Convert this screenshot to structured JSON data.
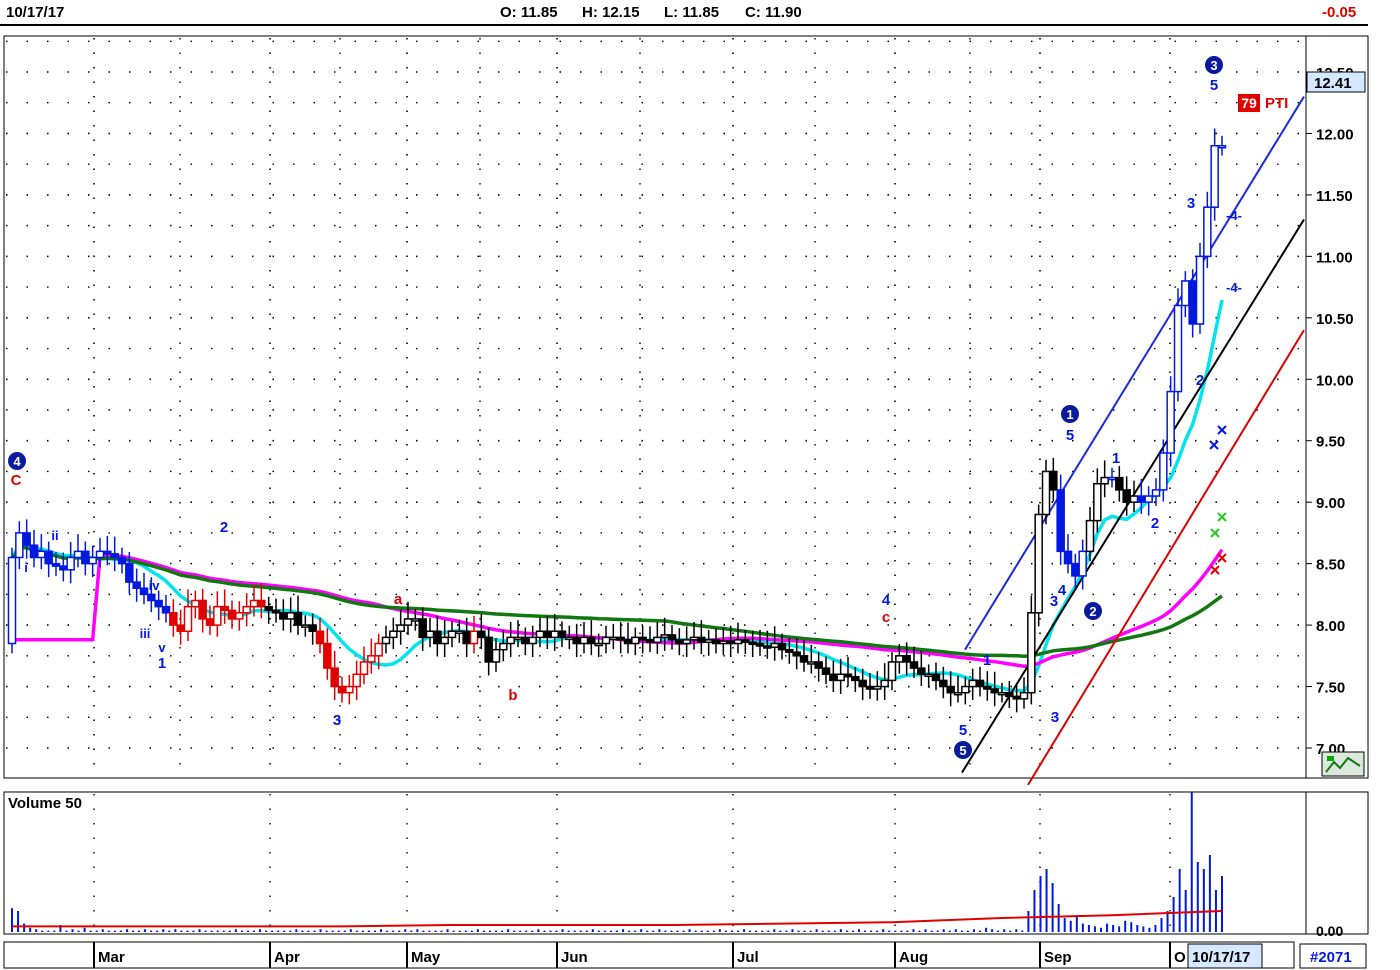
{
  "header": {
    "date": "10/17/17",
    "open": "O: 11.85",
    "high": "H: 12.15",
    "low": "L: 11.85",
    "close": "C: 11.90",
    "change": "-0.05"
  },
  "colors": {
    "down_candle": "#e00000",
    "up_candle_blue": "#0018e0",
    "neutral_candle": "#000000",
    "ma_fast": "#00e5ee",
    "ma_mid": "#ff00ff",
    "ma_slow": "#117711",
    "channel_blue": "#1a2adc",
    "channel_black": "#000000",
    "channel_red": "#e00000"
  },
  "icons": {
    "corner": "chart-tools-icon"
  },
  "chart_data": {
    "type": "candlestick",
    "price_axis": {
      "range": [
        6.9,
        12.9
      ],
      "ticks": [
        "7.00",
        "7.50",
        "8.00",
        "8.50",
        "9.00",
        "9.50",
        "10.00",
        "10.50",
        "11.00",
        "11.50",
        "12.00",
        "12.50"
      ],
      "last_price": "12.41"
    },
    "months": [
      "Mar",
      "Apr",
      "May",
      "Jun",
      "Jul",
      "Aug",
      "Sep",
      "O"
    ],
    "date_marker": "10/17/17",
    "chart_id": "#2071",
    "volume_panel": {
      "title": "Volume 50",
      "ticks": [
        "0.00"
      ],
      "volumes": [
        0.17,
        0.15,
        0.06,
        0.03,
        0.02,
        0.01,
        0.01,
        0.01,
        0.05,
        0.01,
        0.02,
        0.01,
        0.03,
        0.01,
        0.01,
        0.02,
        0.01,
        0.01,
        0.01,
        0.02,
        0.01,
        0.01,
        0.02,
        0.01,
        0.01,
        0.02,
        0.01,
        0.02,
        0.01,
        0.01,
        0.01,
        0.02,
        0.01,
        0.01,
        0.01,
        0.01,
        0.01,
        0.02,
        0.01,
        0.01,
        0.01,
        0.02,
        0.01,
        0.01,
        0.01,
        0.01,
        0.01,
        0.02,
        0.01,
        0.01,
        0.01,
        0.02,
        0.01,
        0.01,
        0.01,
        0.01,
        0.02,
        0.01,
        0.01,
        0.01,
        0.01,
        0.02,
        0.01,
        0.01,
        0.01,
        0.02,
        0.01,
        0.02,
        0.01,
        0.01,
        0.01,
        0.01,
        0.02,
        0.01,
        0.01,
        0.01,
        0.01,
        0.02,
        0.01,
        0.01,
        0.01,
        0.01,
        0.02,
        0.01,
        0.01,
        0.01,
        0.01,
        0.02,
        0.01,
        0.01,
        0.01,
        0.02,
        0.01,
        0.01,
        0.01,
        0.01,
        0.02,
        0.01,
        0.01,
        0.01,
        0.01,
        0.02,
        0.01,
        0.01,
        0.02,
        0.01,
        0.01,
        0.02,
        0.01,
        0.01,
        0.01,
        0.01,
        0.02,
        0.01,
        0.01,
        0.01,
        0.01,
        0.02,
        0.01,
        0.01,
        0.01,
        0.02,
        0.01,
        0.01,
        0.01,
        0.01,
        0.02,
        0.01,
        0.01,
        0.02,
        0.01,
        0.01,
        0.01,
        0.02,
        0.01,
        0.01,
        0.01,
        0.02,
        0.01,
        0.01,
        0.02,
        0.01,
        0.01,
        0.01,
        0.02,
        0.01,
        0.01,
        0.01,
        0.01,
        0.02,
        0.01,
        0.02,
        0.01,
        0.01,
        0.02,
        0.01,
        0.02,
        0.01,
        0.01,
        0.02,
        0.01,
        0.03,
        0.02,
        0.01,
        0.02,
        0.01,
        0.02,
        0.01,
        0.15,
        0.3,
        0.4,
        0.45,
        0.35,
        0.2,
        0.1,
        0.08,
        0.12,
        0.06,
        0.05,
        0.04,
        0.03,
        0.06,
        0.05,
        0.04,
        0.08,
        0.07,
        0.05,
        0.04,
        0.03,
        0.05,
        0.1,
        0.15,
        0.25,
        0.45,
        0.3,
        1.0,
        0.5,
        0.45,
        0.55,
        0.3,
        0.4
      ],
      "average_line": [
        0.04,
        0.04,
        0.04,
        0.04,
        0.05,
        0.05,
        0.05,
        0.06,
        0.07,
        0.1,
        0.12,
        0.15
      ]
    },
    "candles_close": [
      8.55,
      8.75,
      8.65,
      8.55,
      8.6,
      8.5,
      8.48,
      8.45,
      8.55,
      8.6,
      8.5,
      8.55,
      8.6,
      8.58,
      8.55,
      8.5,
      8.35,
      8.3,
      8.25,
      8.2,
      8.15,
      8.1,
      8.0,
      7.95,
      8.15,
      8.2,
      8.05,
      8.0,
      8.15,
      8.12,
      8.05,
      8.1,
      8.15,
      8.2,
      8.15,
      8.12,
      8.1,
      8.05,
      8.1,
      8.0,
      8.0,
      7.95,
      7.85,
      7.65,
      7.5,
      7.45,
      7.5,
      7.6,
      7.7,
      7.75,
      7.85,
      7.9,
      7.95,
      8.0,
      8.05,
      8.05,
      7.9,
      7.95,
      7.85,
      7.9,
      7.95,
      7.95,
      7.85,
      7.95,
      7.9,
      7.7,
      7.8,
      7.85,
      7.9,
      7.9,
      7.85,
      7.9,
      7.95,
      7.9,
      7.95,
      7.9,
      7.9,
      7.85,
      7.9,
      7.85,
      7.85,
      7.9,
      7.9,
      7.88,
      7.85,
      7.9,
      7.88,
      7.86,
      7.9,
      7.92,
      7.88,
      7.85,
      7.88,
      7.9,
      7.86,
      7.88,
      7.85,
      7.87,
      7.85,
      7.88,
      7.86,
      7.85,
      7.83,
      7.82,
      7.85,
      7.8,
      7.78,
      7.75,
      7.7,
      7.7,
      7.65,
      7.6,
      7.55,
      7.6,
      7.58,
      7.55,
      7.5,
      7.48,
      7.5,
      7.55,
      7.7,
      7.75,
      7.7,
      7.65,
      7.6,
      7.6,
      7.55,
      7.5,
      7.45,
      7.45,
      7.5,
      7.55,
      7.5,
      7.48,
      7.45,
      7.45,
      7.42,
      7.4,
      7.45,
      8.1,
      8.9,
      9.25,
      9.1,
      8.6,
      8.5,
      8.4,
      8.6,
      8.85,
      9.15,
      9.2,
      9.2,
      9.1,
      9.0,
      9.05,
      9.0,
      9.05,
      9.1,
      9.4,
      9.9,
      10.6,
      10.8,
      10.45,
      11.0,
      11.4,
      11.9,
      11.9
    ],
    "labels": [
      "1",
      "2",
      "3",
      "4",
      "5",
      "1",
      "2",
      "3",
      "4",
      "5",
      "i",
      "ii",
      "iii",
      "iv",
      "v",
      "a",
      "b",
      "c",
      "C",
      "3",
      "1",
      "2",
      "3",
      "1",
      "2",
      "3",
      "5",
      "-4-",
      "-4-",
      "79",
      "PTI"
    ],
    "circled_labels": [
      "4",
      "5",
      "1",
      "2",
      "3"
    ]
  }
}
